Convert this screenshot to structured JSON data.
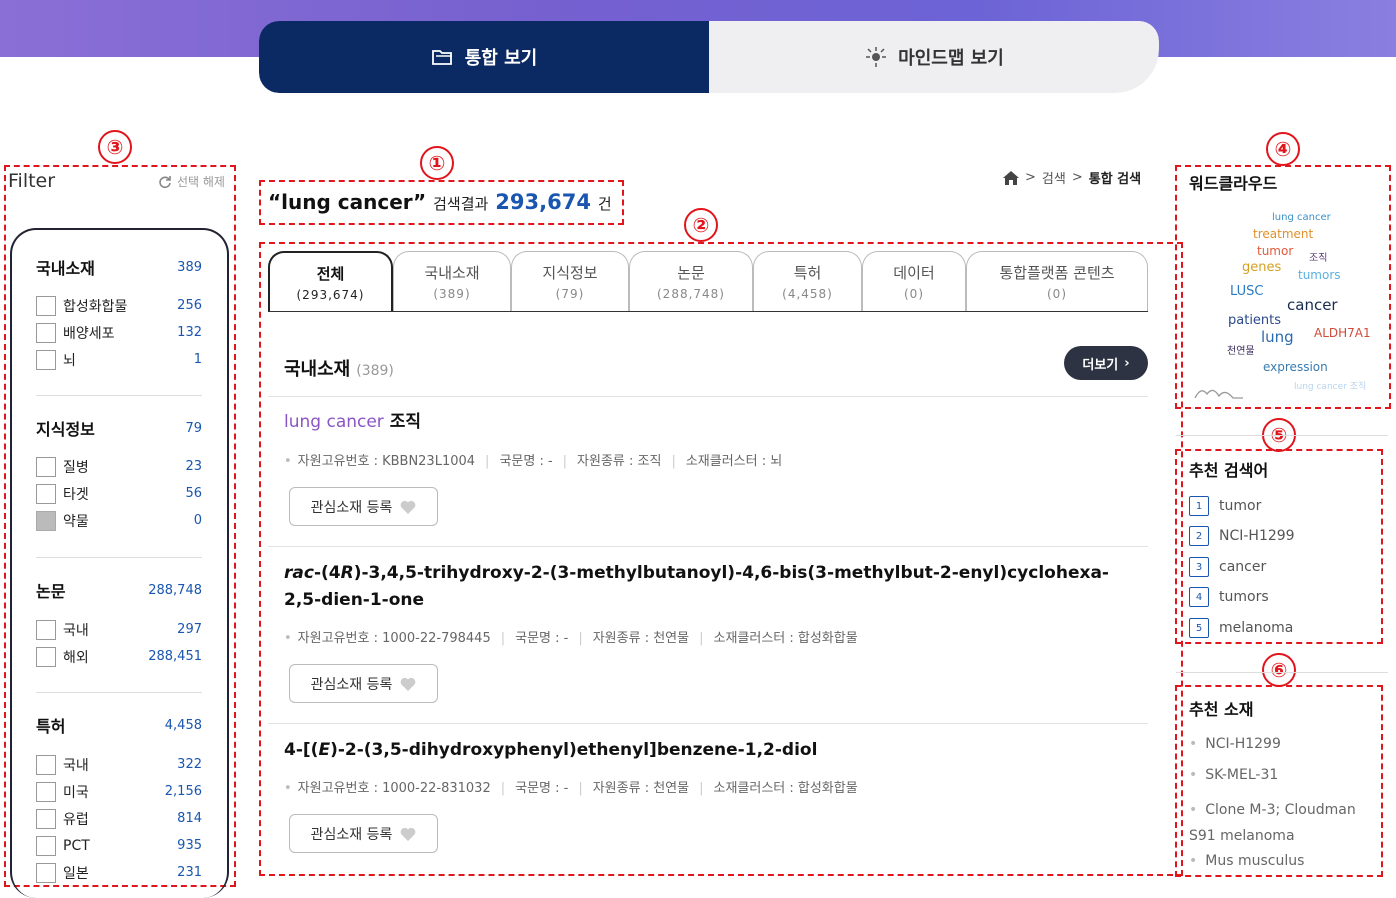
{
  "view_tabs": {
    "integrated": "통합 보기",
    "mindmap": "마인드맵 보기"
  },
  "markers": [
    "①",
    "②",
    "③",
    "④",
    "⑤",
    "⑥"
  ],
  "filter": {
    "title": "Filter",
    "reset": "선택 해제",
    "groups": [
      {
        "label": "국내소재",
        "count": "389",
        "items": [
          {
            "label": "합성화합물",
            "count": "256"
          },
          {
            "label": "배양세포",
            "count": "132"
          },
          {
            "label": "뇌",
            "count": "1"
          }
        ]
      },
      {
        "label": "지식정보",
        "count": "79",
        "items": [
          {
            "label": "질병",
            "count": "23"
          },
          {
            "label": "타겟",
            "count": "56"
          },
          {
            "label": "약물",
            "count": "0"
          }
        ]
      },
      {
        "label": "논문",
        "count": "288,748",
        "items": [
          {
            "label": "국내",
            "count": "297"
          },
          {
            "label": "해외",
            "count": "288,451"
          }
        ]
      },
      {
        "label": "특허",
        "count": "4,458",
        "items": [
          {
            "label": "국내",
            "count": "322"
          },
          {
            "label": "미국",
            "count": "2,156"
          },
          {
            "label": "유럽",
            "count": "814"
          },
          {
            "label": "PCT",
            "count": "935"
          },
          {
            "label": "일본",
            "count": "231"
          }
        ]
      }
    ]
  },
  "query": {
    "term": "“lung cancer”",
    "label": "검색결과",
    "total": "293,674",
    "unit": "건"
  },
  "breadcrumb": {
    "sep": ">",
    "items": [
      "검색",
      "통합 검색"
    ]
  },
  "tabs": [
    {
      "label": "전체",
      "count": "(293,674)"
    },
    {
      "label": "국내소재",
      "count": "(389)"
    },
    {
      "label": "지식정보",
      "count": "(79)"
    },
    {
      "label": "논문",
      "count": "(288,748)"
    },
    {
      "label": "특허",
      "count": "(4,458)"
    },
    {
      "label": "데이터",
      "count": "(0)"
    },
    {
      "label": "통합플랫폼 콘텐츠",
      "count": "(0)"
    }
  ],
  "section": {
    "title": "국내소재",
    "count": "(389)",
    "more": "더보기"
  },
  "results": [
    {
      "title_hl": "lung cancer",
      "title_rest": " 조직",
      "meta": [
        "자원고유번호 : KBBN23L1004",
        "국문명 : -",
        "자원종류 : 조직",
        "소재클러스터 : 뇌"
      ],
      "button": "관심소재 등록"
    },
    {
      "title_i1": "rac",
      "title_p1": "-(4",
      "title_i2": "R",
      "title_p2": ")-3,4,5-trihydroxy-2-(3-methylbutanoyl)-4,6-bis(3-methylbut-2-enyl)cyclohexa-2,5-dien-1-one",
      "meta": [
        "자원고유번호 : 1000-22-798445",
        "국문명 : -",
        "자원종류 : 천연물",
        "소재클러스터 : 합성화합물"
      ],
      "button": "관심소재 등록"
    },
    {
      "title_p1": "4-[(",
      "title_i1": "E",
      "title_p2": ")-2-(3,5-dihydroxyphenyl)ethenyl]benzene-1,2-diol",
      "meta": [
        "자원고유번호 : 1000-22-831032",
        "국문명 : -",
        "자원종류 : 천연물",
        "소재클러스터 : 합성화합물"
      ],
      "button": "관심소재 등록"
    }
  ],
  "wordcloud": {
    "title": "워드클라우드",
    "words": [
      {
        "text": "lung cancer",
        "color": "#3a8fc9"
      },
      {
        "text": "treatment",
        "color": "#e0902a"
      },
      {
        "text": "tumor",
        "color": "#e05a3a"
      },
      {
        "text": "조직",
        "color": "#5a3a7a"
      },
      {
        "text": "genes",
        "color": "#d4a020"
      },
      {
        "text": "tumors",
        "color": "#5ab0e0"
      },
      {
        "text": "LUSC",
        "color": "#2a7ac0"
      },
      {
        "text": "cancer",
        "color": "#1a2a50"
      },
      {
        "text": "patients",
        "color": "#2a4a8a"
      },
      {
        "text": "lung",
        "color": "#2a6ab0"
      },
      {
        "text": "ALDH7A1",
        "color": "#d04a3a"
      },
      {
        "text": "천연물",
        "color": "#3a2a5a"
      },
      {
        "text": "expression",
        "color": "#3a7ab0"
      },
      {
        "text": "lung cancer 조직",
        "color": "#b8d4ee"
      }
    ]
  },
  "recommend_search": {
    "title": "추천 검색어",
    "items": [
      {
        "n": "1",
        "t": "tumor"
      },
      {
        "n": "2",
        "t": "NCI-H1299"
      },
      {
        "n": "3",
        "t": "cancer"
      },
      {
        "n": "4",
        "t": "tumors"
      },
      {
        "n": "5",
        "t": "melanoma"
      }
    ]
  },
  "recommend_material": {
    "title": "추천 소재",
    "items": [
      "NCI-H1299",
      "SK-MEL-31",
      "Clone M-3; Cloudman S91 melanoma",
      "Mus musculus"
    ]
  }
}
